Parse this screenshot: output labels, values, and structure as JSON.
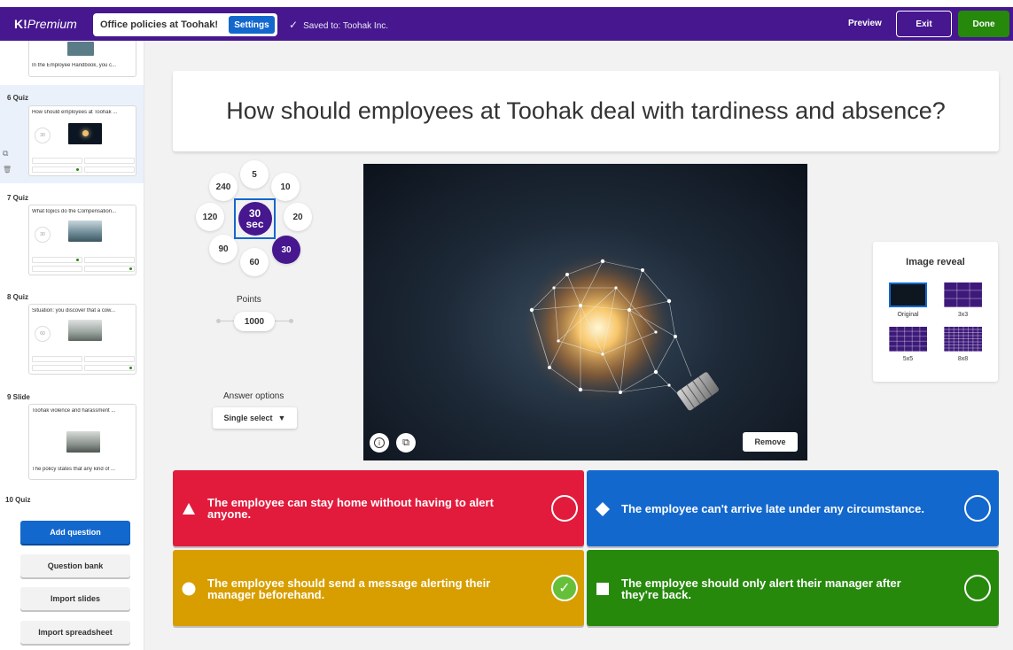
{
  "app": {
    "logo_k": "K!",
    "logo_text": "Premium",
    "kahoot_title": "Office policies at Toohak!",
    "settings_label": "Settings",
    "saved_text": "Saved to: Toohak Inc.",
    "preview_label": "Preview",
    "exit_label": "Exit",
    "done_label": "Done"
  },
  "sidebar": {
    "top_card_text": "In the Employee Handbook, you c...",
    "items": [
      {
        "label": "6  Quiz",
        "question": "How should employees at Toohak ...",
        "time": "30"
      },
      {
        "label": "7  Quiz",
        "question": "What topics do the Compensation...",
        "time": "30"
      },
      {
        "label": "8  Quiz",
        "question": "Situation: you discover that a cow...",
        "time": "60"
      },
      {
        "label": "9  Slide",
        "question": "Toohak violence and harassment ...",
        "footer": "The policy states that any kind of ..."
      },
      {
        "label": "10  Quiz"
      }
    ],
    "buttons": {
      "add_question": "Add question",
      "question_bank": "Question bank",
      "import_slides": "Import slides",
      "import_spreadsheet": "Import spreadsheet"
    }
  },
  "question": {
    "text": "How should employees at Toohak deal with tardiness and absence?"
  },
  "time_limit": {
    "options": [
      "5",
      "10",
      "20",
      "30",
      "60",
      "90",
      "120",
      "240"
    ],
    "selected_value": "30",
    "selected_unit": "sec"
  },
  "points": {
    "label": "Points",
    "value": "1000"
  },
  "answer_options": {
    "label": "Answer options",
    "value": "Single select",
    "arrow": "▼"
  },
  "image": {
    "remove_label": "Remove",
    "info_icon": "i",
    "crop_icon": "⧉"
  },
  "image_reveal": {
    "title": "Image reveal",
    "options": [
      "Original",
      "3x3",
      "5x5",
      "8x8"
    ],
    "selected": "Original"
  },
  "answers": [
    {
      "text": "The employee can stay home without having to alert anyone.",
      "color": "#e21b3c",
      "shape": "triangle",
      "correct": false
    },
    {
      "text": "The employee can't arrive late under any circumstance.",
      "color": "#1368ce",
      "shape": "diamond",
      "correct": false
    },
    {
      "text": "The employee should send a message alerting their manager beforehand.",
      "color": "#d89e00",
      "shape": "circle",
      "correct": true
    },
    {
      "text": "The employee should only alert their manager after they're back.",
      "color": "#26890c",
      "shape": "square",
      "correct": false
    }
  ],
  "colors": {
    "brand_purple": "#46178f",
    "blue": "#1368ce",
    "green": "#26890c",
    "check_green": "#66bf39"
  },
  "icons": {
    "check": "✓",
    "duplicate": "⧉",
    "trash": "🗑"
  }
}
